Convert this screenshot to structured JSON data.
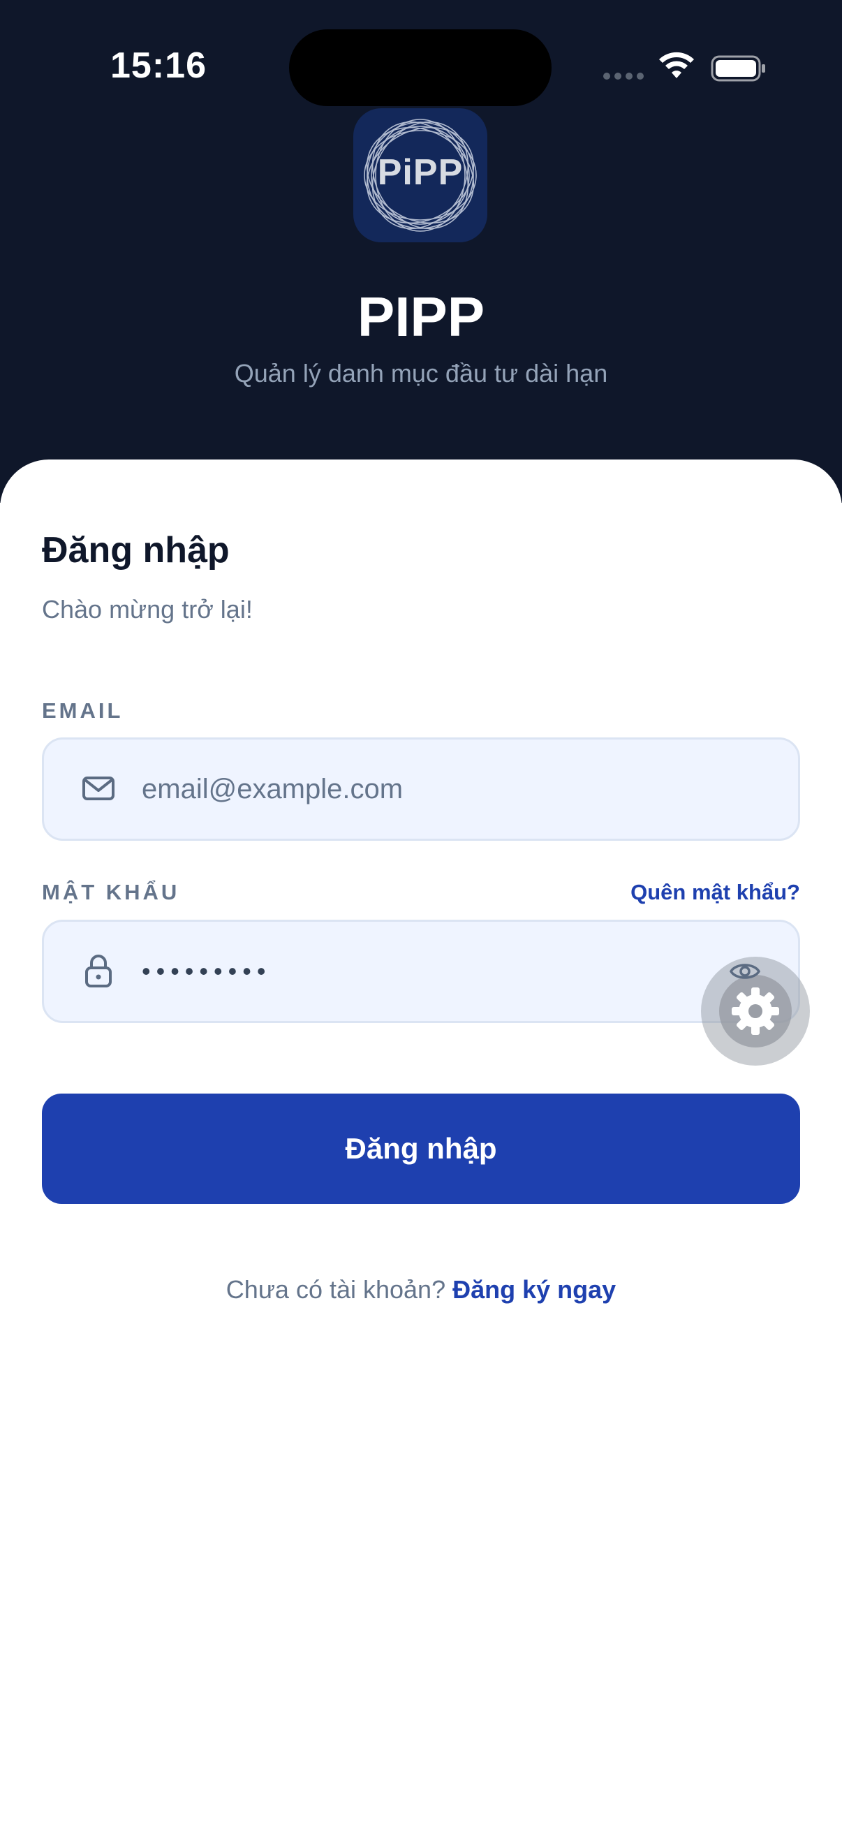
{
  "status_bar": {
    "time": "15:16"
  },
  "app": {
    "logo_text": "PiPP",
    "name": "PIPP",
    "tagline": "Quản lý danh mục đầu tư dài hạn"
  },
  "login": {
    "title": "Đăng nhập",
    "subtitle": "Chào mừng trở lại!",
    "email": {
      "label": "EMAIL",
      "placeholder": "email@example.com",
      "value": ""
    },
    "password": {
      "label": "MẬT KHẨU",
      "forgot_label": "Quên mật khẩu?",
      "value": "•••••••••"
    },
    "submit_label": "Đăng nhập",
    "signup_prompt": "Chưa có tài khoản?",
    "signup_link": "Đăng ký ngay"
  },
  "icons": {
    "email": "mail-icon",
    "password": "lock-icon",
    "toggle_visibility": "eye-icon",
    "floating": "gear-icon"
  },
  "colors": {
    "header_bg": "#0f172a",
    "primary": "#1e40af",
    "input_bg": "#eff4ff",
    "muted_text": "#64748b"
  }
}
